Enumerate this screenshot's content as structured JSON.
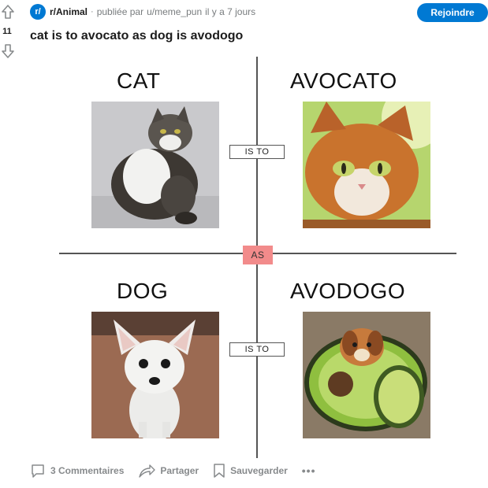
{
  "vote": {
    "count": "11"
  },
  "post": {
    "subreddit_icon_text": "r/",
    "subreddit": "r/Animal",
    "separator": "·",
    "posted_by": "publiée par",
    "author": "u/meme_pun",
    "time_ago": "il y a 7 jours",
    "title": "cat is to avocato as dog is avodogo"
  },
  "join_button": "Rejoindre",
  "image": {
    "label_cat": "CAT",
    "label_avocato": "AVOCATO",
    "label_dog": "DOG",
    "label_avodogo": "AVODOGO",
    "is_to_top": "IS TO",
    "is_to_bottom": "IS TO",
    "as_label": "AS"
  },
  "actions": {
    "comments": "3 Commentaires",
    "share": "Partager",
    "save": "Sauvegarder",
    "more": "•••"
  },
  "colors": {
    "accent": "#0079d3",
    "as_box": "#f28b8b"
  }
}
